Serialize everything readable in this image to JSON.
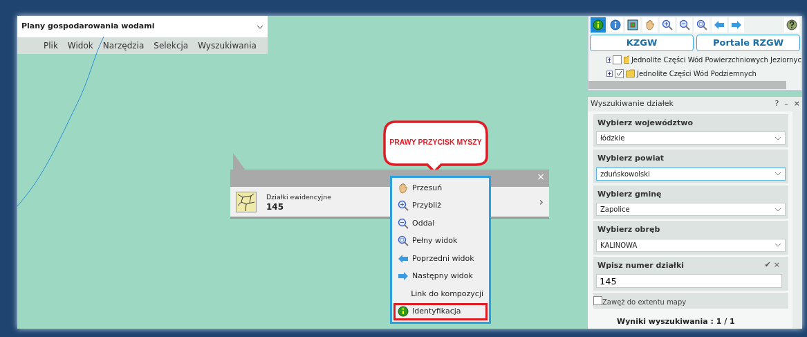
{
  "map_title": {
    "text": "Plany gospodarowania wodami"
  },
  "menu": [
    "Plik",
    "Widok",
    "Narzędzia",
    "Selekcja",
    "Wyszukiwania"
  ],
  "toolbar": [
    {
      "kind": "identify",
      "selected": true
    },
    {
      "kind": "info",
      "selected": false
    },
    {
      "kind": "extent",
      "selected": false
    },
    {
      "kind": "pan",
      "selected": false
    },
    {
      "kind": "zoomin",
      "selected": false
    },
    {
      "kind": "zoomout",
      "selected": false
    },
    {
      "kind": "full",
      "selected": false
    },
    {
      "kind": "back",
      "selected": false
    },
    {
      "kind": "forward",
      "selected": false
    },
    {
      "kind": "help",
      "selected": false
    }
  ],
  "portal_buttons": [
    "KZGW",
    "Portale RZGW"
  ],
  "layers": [
    {
      "label": "Jednolite Części Wód Powierzchniowych Jeziornyc",
      "checked": false
    },
    {
      "label": "Jednolite Części Wód Podziemnych",
      "checked": true
    }
  ],
  "callout": {
    "text": "PRAWY PRZYCISK MYSZY"
  },
  "popup": {
    "layer": "Działki ewidencyjne",
    "value": "145",
    "close": "×",
    "chevron": "›"
  },
  "context_menu": [
    {
      "kind": "pan",
      "label": "Przesuń",
      "selected": false
    },
    {
      "kind": "zoomin",
      "label": "Przybliż",
      "selected": false
    },
    {
      "kind": "zoomout",
      "label": "Oddal",
      "selected": false
    },
    {
      "kind": "full",
      "label": "Pełny widok",
      "selected": false
    },
    {
      "kind": "back",
      "label": "Poprzedni widok",
      "selected": false
    },
    {
      "kind": "forward",
      "label": "Następny widok",
      "selected": false
    },
    {
      "kind": "none",
      "label": "Link do kompozycji",
      "selected": false
    },
    {
      "kind": "identify",
      "label": "Identyfikacja",
      "selected": true
    }
  ],
  "search_panel": {
    "title": "Wyszukiwanie działek",
    "help": "?",
    "minimize": "–",
    "close": "×",
    "selects": [
      {
        "label": "Wybierz województwo",
        "value": "łódzkie",
        "focused": false
      },
      {
        "label": "Wybierz powiat",
        "value": "zduńskowolski",
        "focused": true
      },
      {
        "label": "Wybierz gminę",
        "value": "Zapolice",
        "focused": false
      },
      {
        "label": "Wybierz obręb",
        "value": "KALINOWA",
        "focused": false
      }
    ],
    "number": {
      "label": "Wpisz numer działki",
      "value": "145",
      "accept": "✔",
      "clear": "×"
    },
    "extent": {
      "label": "Zawęż do extentu mapy",
      "checked": false
    },
    "results": "Wyniki wyszukiwania : 1 / 1"
  }
}
